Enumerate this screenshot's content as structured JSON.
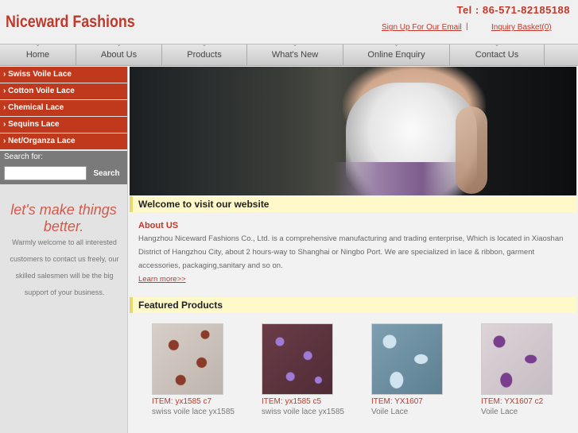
{
  "header": {
    "logo": "Niceward Fashions",
    "tel": "Tel : 86-571-82185188",
    "signup": "Sign Up For Our Email",
    "separator": "|",
    "inquiry": "Inquiry Basket(0)"
  },
  "nav": {
    "items": [
      "Home",
      "About Us",
      "Products",
      "What's New",
      "Online Enquiry",
      "Contact Us"
    ]
  },
  "sidebar": {
    "categories": [
      "Swiss Voile Lace",
      "Cotton Voile Lace",
      "Chemical Lace",
      "Sequins Lace",
      "Net/Organza Lace"
    ],
    "search_label": "Search for:",
    "search_value": "",
    "search_button": "Search",
    "slogan": "let's make things better.",
    "slogan_body": "Warmly welcome to all interested customers to contact us freely, our skilled salesmen will be the big support of your business."
  },
  "welcome": {
    "heading": "Welcome to visit our website",
    "about_title": "About US",
    "about_text": "Hangzhou Niceward Fashions Co., Ltd. is a comprehensive manufacturing and trading enterprise, Which is located in Xiaoshan District of Hangzhou City, about 2 hours-way to Shanghai or Ningbo Port. We are specialized in lace & ribbon, garment accessories, packaging,sanitary and so on.",
    "learn_more": "Learn more>>"
  },
  "featured": {
    "heading": "Featured Products",
    "products": [
      {
        "item": "ITEM: yx1585 c7",
        "desc": "swiss voile lace yx1585"
      },
      {
        "item": "ITEM: yx1585 c5",
        "desc": "swiss voile lace yx1585"
      },
      {
        "item": "ITEM: YX1607",
        "desc": "Voile Lace"
      },
      {
        "item": "ITEM: YX1607 c2",
        "desc": "Voile Lace"
      }
    ]
  },
  "colors": {
    "brand_red": "#c0392b",
    "category_bg": "#c1391c",
    "section_bar": "#fff8c8"
  },
  "icons": {
    "category_marker": "chevron-right-icon",
    "nav_marker": "chevron-down-icon"
  }
}
